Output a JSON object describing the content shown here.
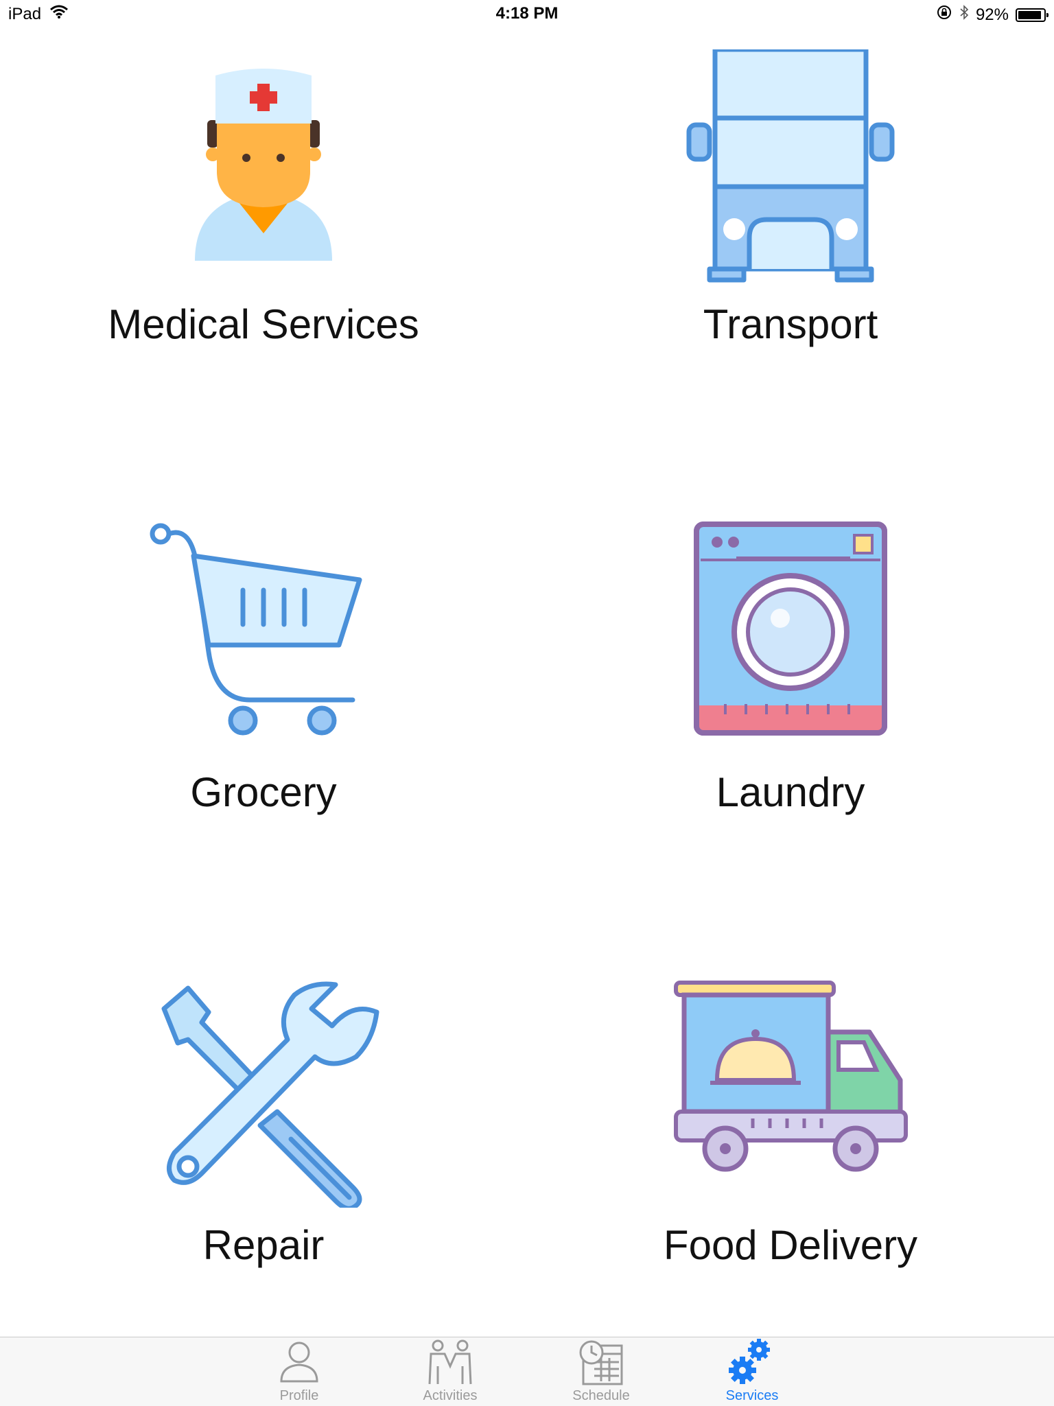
{
  "status_bar": {
    "device": "iPad",
    "time": "4:18 PM",
    "battery_percent": "92%",
    "battery_level": 0.92,
    "icons": [
      "wifi-icon",
      "orientation-lock-icon",
      "bluetooth-icon",
      "battery-icon"
    ]
  },
  "services": [
    {
      "label": "Medical Services",
      "icon": "doctor-icon"
    },
    {
      "label": "Transport",
      "icon": "bus-icon"
    },
    {
      "label": "Grocery",
      "icon": "shopping-cart-icon"
    },
    {
      "label": "Laundry",
      "icon": "washing-machine-icon"
    },
    {
      "label": "Repair",
      "icon": "wrench-screwdriver-icon"
    },
    {
      "label": "Food Delivery",
      "icon": "delivery-truck-icon"
    }
  ],
  "tab_bar": {
    "tabs": [
      {
        "label": "Profile",
        "icon": "person-icon",
        "active": false
      },
      {
        "label": "Activities",
        "icon": "people-icon",
        "active": false
      },
      {
        "label": "Schedule",
        "icon": "calendar-clock-icon",
        "active": false
      },
      {
        "label": "Services",
        "icon": "gears-icon",
        "active": true
      }
    ]
  },
  "colors": {
    "active_tab": "#1a7cf4",
    "inactive_tab": "#9a9a9a",
    "icon_blue_stroke": "#4a90d9",
    "icon_blue_fill": "#cfe6fb",
    "icon_purple_stroke": "#8b6aa8"
  }
}
